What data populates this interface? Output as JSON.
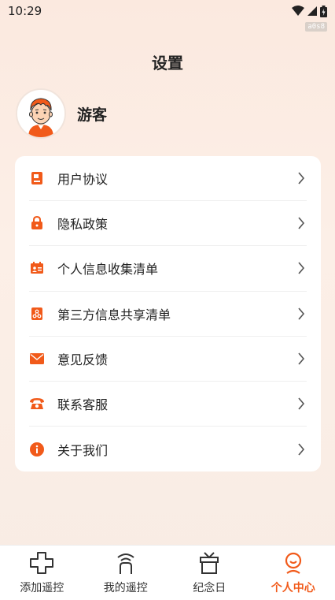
{
  "status_bar": {
    "time": "10:29",
    "build_tag": "a0s8"
  },
  "header": {
    "title": "设置"
  },
  "profile": {
    "username": "游客"
  },
  "menu": {
    "items": [
      {
        "label": "用户协议",
        "icon": "document-icon"
      },
      {
        "label": "隐私政策",
        "icon": "lock-icon"
      },
      {
        "label": "个人信息收集清单",
        "icon": "id-card-icon"
      },
      {
        "label": "第三方信息共享清单",
        "icon": "share-icon"
      },
      {
        "label": "意见反馈",
        "icon": "mail-icon"
      },
      {
        "label": "联系客服",
        "icon": "phone-icon"
      },
      {
        "label": "关于我们",
        "icon": "info-icon"
      }
    ]
  },
  "tabs": [
    {
      "label": "添加遥控",
      "icon": "dpad-plus-icon",
      "active": false
    },
    {
      "label": "我的遥控",
      "icon": "remote-icon",
      "active": false
    },
    {
      "label": "纪念日",
      "icon": "gift-box-icon",
      "active": false
    },
    {
      "label": "个人中心",
      "icon": "person-icon",
      "active": true
    }
  ],
  "colors": {
    "accent": "#f15a1a",
    "background": "#fbe9df",
    "card": "#ffffff"
  }
}
